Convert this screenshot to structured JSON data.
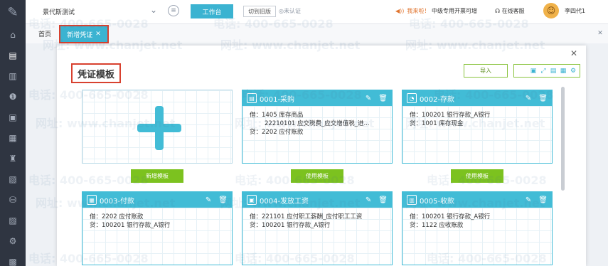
{
  "sidebar": {
    "logo_icon": "feather-logo-icon",
    "items": [
      {
        "icon": "home-icon",
        "glyph": "⌂"
      },
      {
        "icon": "voucher-icon",
        "glyph": "▤",
        "active": true
      },
      {
        "icon": "chart-icon",
        "glyph": "▥"
      },
      {
        "icon": "money-bag-icon",
        "glyph": "❶"
      },
      {
        "icon": "book-icon",
        "glyph": "▣"
      },
      {
        "icon": "report-icon",
        "glyph": "▦"
      },
      {
        "icon": "bank-icon",
        "glyph": "♜"
      },
      {
        "icon": "invoice-icon",
        "glyph": "▧"
      },
      {
        "icon": "cart-icon",
        "glyph": "⛁"
      },
      {
        "icon": "receipt-icon",
        "glyph": "▨"
      },
      {
        "icon": "settings-icon",
        "glyph": "⚙"
      },
      {
        "icon": "lock-icon",
        "glyph": "▩"
      }
    ]
  },
  "topbar": {
    "account": "景代斯测试",
    "workbench": "工作台",
    "switch_old": "切到旧版",
    "unverified": "未认证",
    "notice": "我来啦！",
    "notice_link": "中级专用开票可增",
    "service": "在线客服",
    "user": "李四代1"
  },
  "tabs": {
    "home": "首页",
    "active": "新增凭证"
  },
  "modal": {
    "title": "凭证模板",
    "import": "导入",
    "add_template": "新增模板",
    "use_template": "使用模板"
  },
  "templates": [
    {
      "code": "0001-采购",
      "icon": "purchase-icon",
      "lines": [
        {
          "dir": "借：",
          "text": "1405 库存商品",
          "cont": false
        },
        {
          "dir": "",
          "text": "22210101 应交税费_应交增值税_进...",
          "cont": true
        },
        {
          "dir": "贷：",
          "text": "2202 应付账款",
          "cont": false
        }
      ]
    },
    {
      "code": "0002-存款",
      "icon": "deposit-icon",
      "lines": [
        {
          "dir": "借：",
          "text": "100201 银行存款_A银行",
          "cont": false
        },
        {
          "dir": "贷：",
          "text": "1001 库存现金",
          "cont": false
        }
      ]
    },
    {
      "code": "0003-付款",
      "icon": "payment-icon",
      "lines": [
        {
          "dir": "借：",
          "text": "2202 应付账款",
          "cont": false
        },
        {
          "dir": "贷：",
          "text": "100201 银行存款_A银行",
          "cont": false
        }
      ]
    },
    {
      "code": "0004-发放工资",
      "icon": "salary-icon",
      "lines": [
        {
          "dir": "借：",
          "text": "221101 应付职工薪酬_应付职工工资",
          "cont": false
        },
        {
          "dir": "贷：",
          "text": "100201 银行存款_A银行",
          "cont": false
        }
      ]
    },
    {
      "code": "0005-收款",
      "icon": "receipt-icon",
      "lines": [
        {
          "dir": "借：",
          "text": "100201 银行存款_A银行",
          "cont": false
        },
        {
          "dir": "贷：",
          "text": "1122 应收账款",
          "cont": false
        }
      ]
    }
  ],
  "watermark": {
    "phone": "电话: 400-665-0028",
    "site": "网址: www.chanjet.net"
  },
  "colors": {
    "sidebar": "#2f3541",
    "accent": "#3bb3d1",
    "card_header": "#42bcd6",
    "green_button": "#7cc21f",
    "highlight_box": "#d8412f"
  }
}
